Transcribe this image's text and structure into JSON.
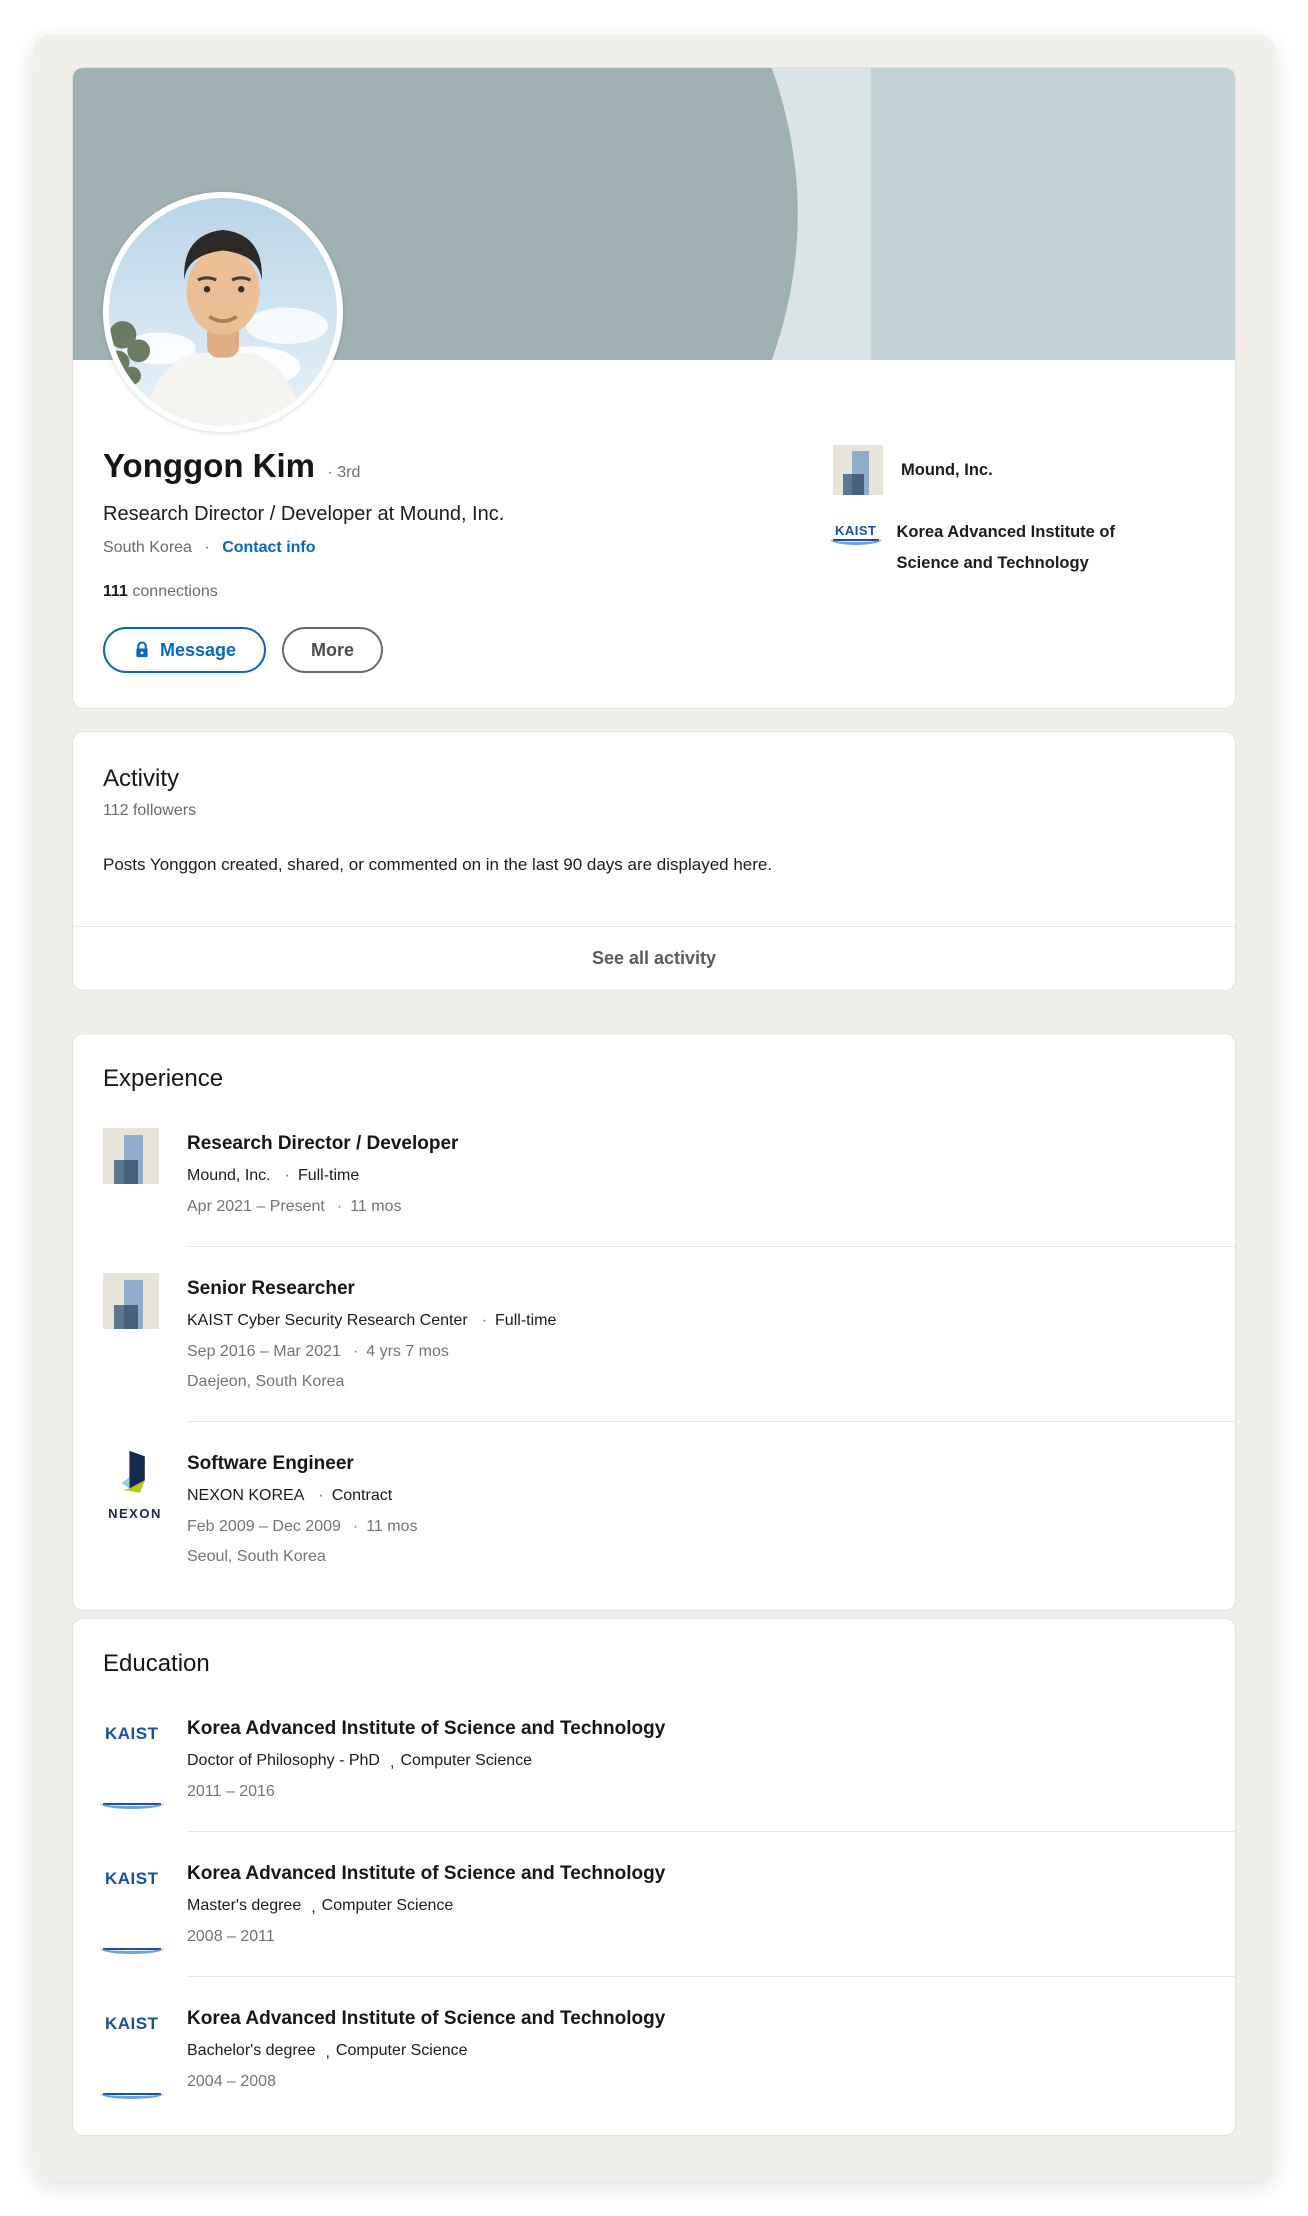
{
  "ui": {
    "dot": "·",
    "comma": ","
  },
  "colors": {
    "accent_blue": "#0a66c2",
    "page_background": "#f1efe9",
    "banner_main": "#9fb1b2",
    "banner_band_light": "#dae4e6",
    "banner_band_right": "#c3d2d5"
  },
  "profile": {
    "name": "Yonggon Kim",
    "degree_badge": "3rd",
    "headline": "Research Director / Developer at Mound, Inc.",
    "location": "South Korea",
    "contact_info": "Contact info",
    "connections_count": "111",
    "connections_label": "connections",
    "message_button": "Message",
    "more_button": "More",
    "organizations": [
      {
        "name": "Mound, Inc."
      },
      {
        "name": "Korea Advanced Institute of Science and Technology"
      }
    ]
  },
  "logos": {
    "kaist_wordmark": "KAIST",
    "nexon_wordmark": "NEXON"
  },
  "activity": {
    "title": "Activity",
    "followers": "112 followers",
    "description": "Posts Yonggon created, shared, or commented on in the last 90 days are displayed here.",
    "see_all": "See all activity"
  },
  "experience": {
    "title": "Experience",
    "items": [
      {
        "role": "Research Director / Developer",
        "company": "Mound, Inc.",
        "employment_type": "Full-time",
        "dates": "Apr 2021 – Present",
        "duration": "11 mos",
        "location": ""
      },
      {
        "role": "Senior Researcher",
        "company": "KAIST Cyber Security Research Center",
        "employment_type": "Full-time",
        "dates": "Sep 2016 – Mar 2021",
        "duration": "4 yrs 7 mos",
        "location": "Daejeon, South Korea"
      },
      {
        "role": "Software Engineer",
        "company": "NEXON KOREA",
        "employment_type": "Contract",
        "dates": "Feb 2009 – Dec 2009",
        "duration": "11 mos",
        "location": "Seoul, South Korea"
      }
    ]
  },
  "education": {
    "title": "Education",
    "items": [
      {
        "school": "Korea Advanced Institute of Science and Technology",
        "degree": "Doctor of Philosophy - PhD",
        "field": "Computer Science",
        "years": "2011  –  2016"
      },
      {
        "school": "Korea Advanced Institute of Science and Technology",
        "degree": "Master's degree",
        "field": "Computer Science",
        "years": "2008  –  2011"
      },
      {
        "school": "Korea Advanced Institute of Science and Technology",
        "degree": "Bachelor's degree",
        "field": "Computer Science",
        "years": "2004  –  2008"
      }
    ]
  }
}
